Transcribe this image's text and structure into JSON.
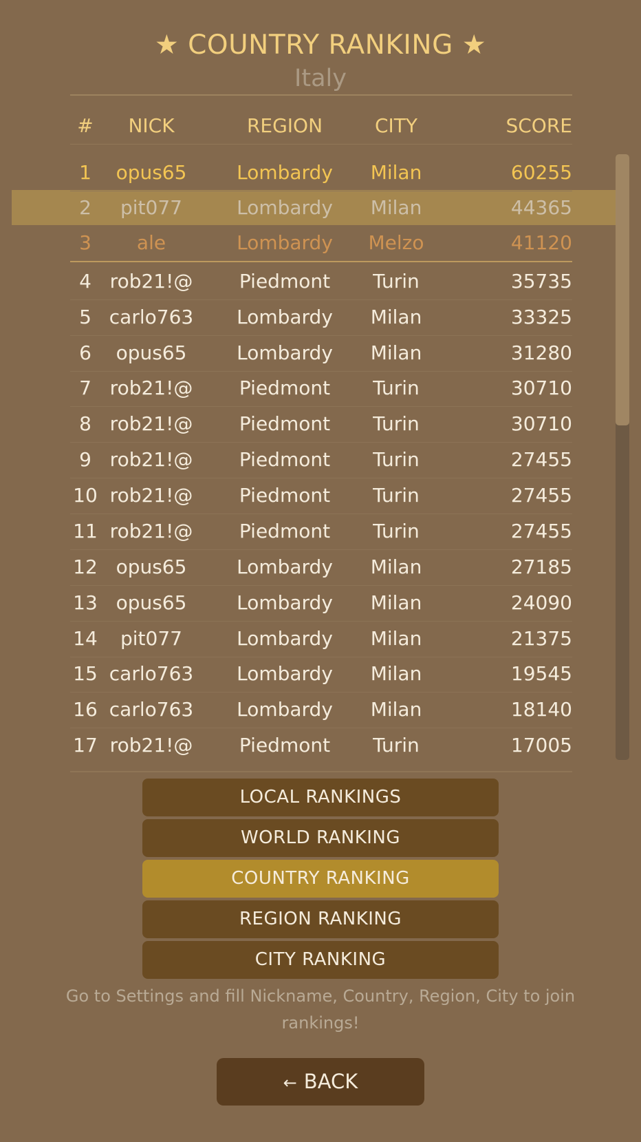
{
  "header": {
    "title": "★ COUNTRY RANKING ★",
    "country": "Italy"
  },
  "table": {
    "columns": [
      "#",
      "NICK",
      "REGION",
      "CITY",
      "SCORE"
    ],
    "rows": [
      [
        "1",
        "opus65",
        "Lombardy",
        "Milan",
        "60255"
      ],
      [
        "2",
        "pit077",
        "Lombardy",
        "Milan",
        "44365"
      ],
      [
        "3",
        "ale",
        "Lombardy",
        "Melzo",
        "41120"
      ],
      [
        "4",
        "rob21!@",
        "Piedmont",
        "Turin",
        "35735"
      ],
      [
        "5",
        "carlo763",
        "Lombardy",
        "Milan",
        "33325"
      ],
      [
        "6",
        "opus65",
        "Lombardy",
        "Milan",
        "31280"
      ],
      [
        "7",
        "rob21!@",
        "Piedmont",
        "Turin",
        "30710"
      ],
      [
        "8",
        "rob21!@",
        "Piedmont",
        "Turin",
        "30710"
      ],
      [
        "9",
        "rob21!@",
        "Piedmont",
        "Turin",
        "27455"
      ],
      [
        "10",
        "rob21!@",
        "Piedmont",
        "Turin",
        "27455"
      ],
      [
        "11",
        "rob21!@",
        "Piedmont",
        "Turin",
        "27455"
      ],
      [
        "12",
        "opus65",
        "Lombardy",
        "Milan",
        "27185"
      ],
      [
        "13",
        "opus65",
        "Lombardy",
        "Milan",
        "24090"
      ],
      [
        "14",
        "pit077",
        "Lombardy",
        "Milan",
        "21375"
      ],
      [
        "15",
        "carlo763",
        "Lombardy",
        "Milan",
        "19545"
      ],
      [
        "16",
        "carlo763",
        "Lombardy",
        "Milan",
        "18140"
      ],
      [
        "17",
        "rob21!@",
        "Piedmont",
        "Turin",
        "17005"
      ]
    ]
  },
  "buttons": {
    "local": "LOCAL RANKINGS",
    "world": "WORLD RANKING",
    "country": "COUNTRY RANKING",
    "region": "REGION RANKING",
    "city": "CITY RANKING"
  },
  "hint": "Go to Settings and fill Nickname, Country, Region, City to join rankings!",
  "back": {
    "arrow": "←",
    "label": "BACK"
  },
  "colors": {
    "background": "#83694d",
    "accent_gold": "#f2cf7e",
    "active_button": "#b28c2c",
    "rank1": "#f3c553",
    "rank2": "#cdbfa8",
    "rank3": "#cf9352"
  }
}
